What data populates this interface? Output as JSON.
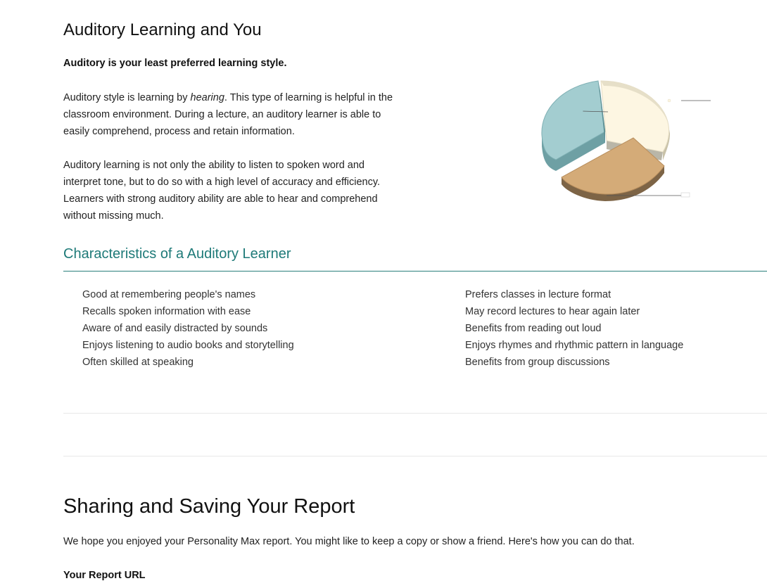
{
  "auditory": {
    "title": "Auditory Learning and You",
    "least_preferred": "Auditory is your least preferred learning style.",
    "p1_before": "Auditory style is learning by ",
    "p1_em": "hearing",
    "p1_after": ". This type of learning is helpful in the classroom environment. During a lecture, an auditory learner is able to easily comprehend, process and retain information.",
    "p2": "Auditory learning is not only the ability to listen to spoken word and interpret tone, but to do so with a high level of accuracy and efficiency. Learners with strong auditory ability are able to hear and comprehend without missing much."
  },
  "chart": {
    "colors": {
      "teal": "#a3cdd0",
      "cream": "#fdf6e2",
      "tan": "#d4ab78"
    }
  },
  "characteristics": {
    "title": "Characteristics of a Auditory Learner",
    "left": [
      "Good at remembering people's names",
      "Recalls spoken information with ease",
      "Aware of and easily distracted by sounds",
      "Enjoys listening to audio books and storytelling",
      "Often skilled at speaking"
    ],
    "right": [
      "Prefers classes in lecture format",
      "May record lectures to hear again later",
      "Benefits from reading out loud",
      "Enjoys rhymes and rhythmic pattern in language",
      "Benefits from group discussions"
    ]
  },
  "sharing": {
    "title": "Sharing and Saving Your Report",
    "text": "We hope you enjoyed your Personality Max report. You might like to keep a copy or show a friend. Here's how you can do that.",
    "url_label": "Your Report URL"
  },
  "colors": {
    "accent": "#1e7a78",
    "rule": "#2a7f7c"
  }
}
